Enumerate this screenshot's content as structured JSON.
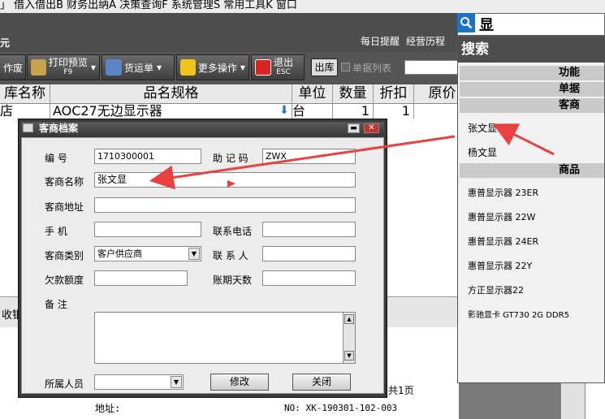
{
  "menubar": {
    "text": "」 借入借出B  财务出纳A  决策查询F  系统管理S  常用工具K  窗口"
  },
  "header": {
    "title": "元",
    "links": [
      "每日提醒",
      "经营历程"
    ]
  },
  "toolbar": {
    "buttons": [
      {
        "label": "作废"
      },
      {
        "label": "打印预览",
        "sub": "F9"
      },
      {
        "label": "货运单"
      },
      {
        "label": "更多操作"
      },
      {
        "label": "退出",
        "sub": "ESC"
      }
    ],
    "outbound": "出库",
    "list_checkbox": "单据列表"
  },
  "table": {
    "headers": [
      "库名称",
      "品名规格",
      "单位",
      "数量",
      "折扣",
      "原价"
    ],
    "row": [
      "店",
      "AOC27无边显示器",
      "台",
      "1",
      "1",
      ""
    ]
  },
  "lower": {
    "receive": "收银",
    "address_label": "地址:",
    "no": "NO: XK-190301-102-003",
    "page": "共1页"
  },
  "search": {
    "query": "显",
    "title": "搜索",
    "categories": {
      "function": "功能",
      "document": "单据",
      "customer": "客商",
      "product": "商品"
    },
    "customers": [
      "张文显",
      "杨文显"
    ],
    "products": [
      "惠普显示器 23ER",
      "惠普显示器 22W",
      "惠普显示器 24ER",
      "惠普显示器 22Y",
      "方正显示器22",
      "影驰显卡 GT730 2G DDR5"
    ]
  },
  "dialog": {
    "title": "客商档案",
    "labels": {
      "code": "编    号",
      "mnemonic": "助 记 码",
      "name": "客商名称",
      "address": "客商地址",
      "mobile": "手    机",
      "phone": "联系电话",
      "category": "客商类别",
      "contact": "联 系 人",
      "debt_limit": "欠款额度",
      "term_days": "账期天数",
      "remarks": "备    注",
      "staff": "所属人员"
    },
    "values": {
      "code": "1710300001",
      "mnemonic": "ZWX",
      "name": "张文显",
      "address": "",
      "mobile": "",
      "phone": "",
      "category": "客户供应商",
      "contact": "",
      "debt_limit": "",
      "term_days": "",
      "remarks": "",
      "staff": ""
    },
    "buttons": {
      "edit": "修改",
      "close": "关闭"
    }
  },
  "colors": {
    "accent_arrow": "#e8413f",
    "search_button": "#1e73c7",
    "dialog_frame": "#3a3a3a"
  }
}
